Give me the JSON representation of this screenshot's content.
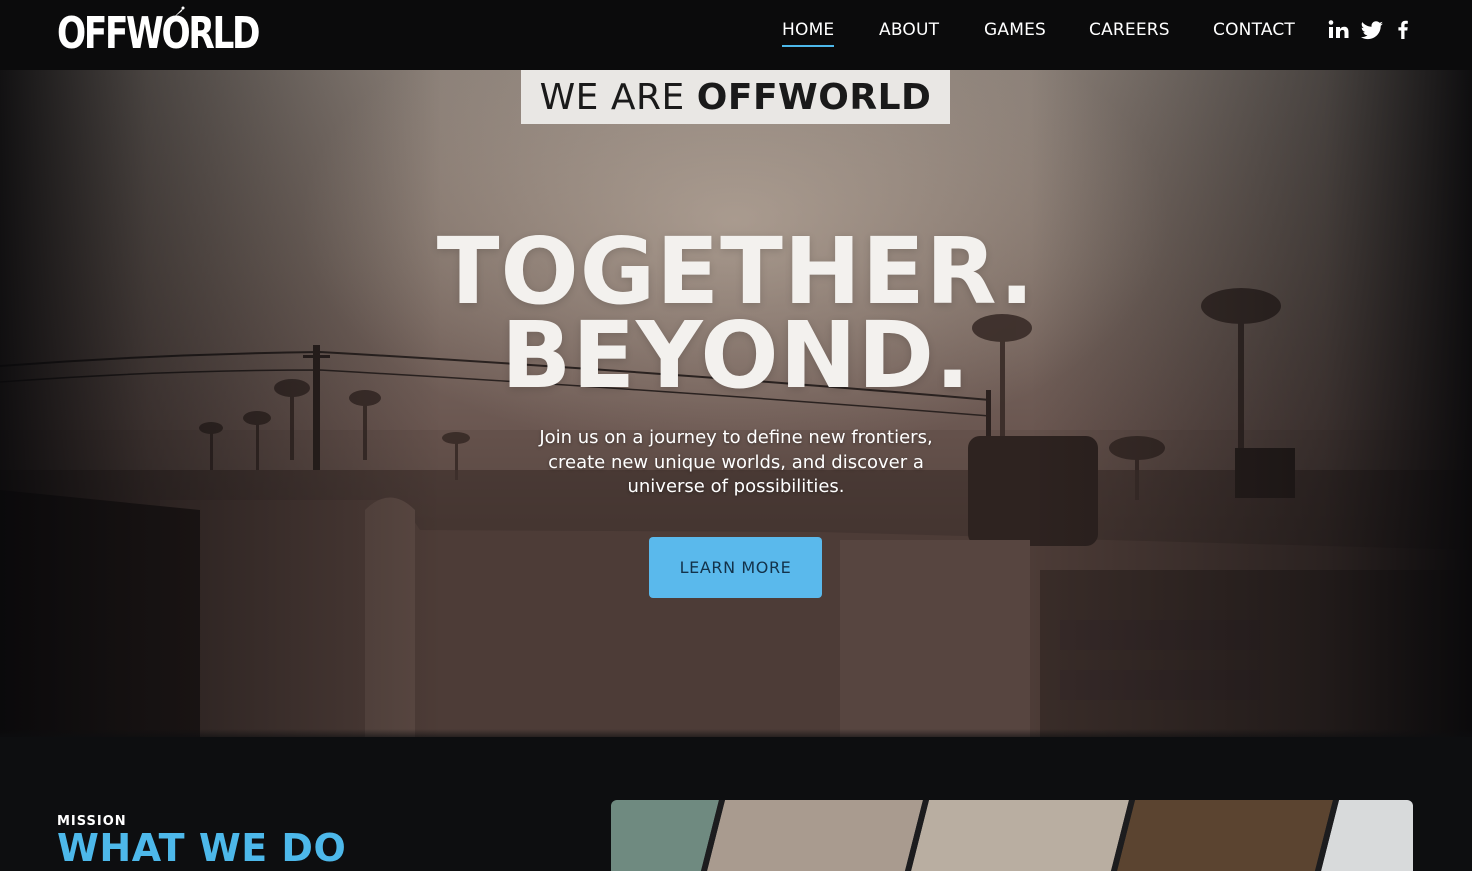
{
  "brand": {
    "logo_text": "OFFWORLD"
  },
  "nav": {
    "items": [
      {
        "label": "HOME",
        "active": true
      },
      {
        "label": "ABOUT",
        "active": false
      },
      {
        "label": "GAMES",
        "active": false
      },
      {
        "label": "CAREERS",
        "active": false
      },
      {
        "label": "CONTACT",
        "active": false
      }
    ],
    "social": [
      "linkedin-icon",
      "twitter-icon",
      "facebook-icon"
    ]
  },
  "hero": {
    "tagline_light": "WE ARE",
    "tagline_bold": "OFFWORLD",
    "headline_line1": "TOGETHER.",
    "headline_line2": "BEYOND.",
    "subtext_line1": "Join us on a journey to define new frontiers,",
    "subtext_line2": "create new unique worlds, and discover a",
    "subtext_line3": "universe of possibilities.",
    "cta_label": "LEARN MORE"
  },
  "mission": {
    "kicker": "MISSION",
    "title": "WHAT WE DO"
  },
  "colors": {
    "accent": "#4db8ea",
    "cta": "#5ab9ec",
    "header_bg": "#0b0b0c",
    "page_bg": "#0d0e10"
  }
}
